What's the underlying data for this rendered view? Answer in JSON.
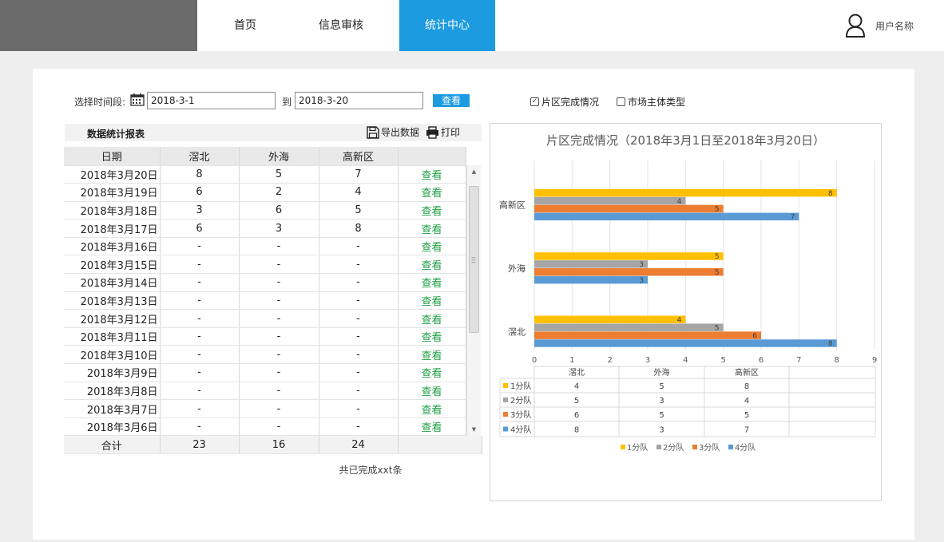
{
  "nav": {
    "items": [
      "首页",
      "信息审核",
      "统计中心"
    ],
    "active": "统计中心",
    "user_name": "用户名称"
  },
  "filter": {
    "label": "选择时间段:",
    "start": "2018-3-1",
    "to": "到",
    "end": "2018-3-20",
    "view_button": "查看",
    "options": [
      {
        "label": "片区完成情况",
        "checked": true
      },
      {
        "label": "市场主体类型",
        "checked": false
      }
    ]
  },
  "report": {
    "title": "数据统计报表",
    "export_label": "导出数据",
    "print_label": "打印",
    "columns": [
      "日期",
      "滘北",
      "外海",
      "高新区",
      ""
    ],
    "rows": [
      [
        "2018年3月20日",
        "8",
        "5",
        "7",
        "查看"
      ],
      [
        "2018年3月19日",
        "6",
        "2",
        "4",
        "查看"
      ],
      [
        "2018年3月18日",
        "3",
        "6",
        "5",
        "查看"
      ],
      [
        "2018年3月17日",
        "6",
        "3",
        "8",
        "查看"
      ],
      [
        "2018年3月16日",
        "-",
        "-",
        "-",
        "查看"
      ],
      [
        "2018年3月15日",
        "-",
        "-",
        "-",
        "查看"
      ],
      [
        "2018年3月14日",
        "-",
        "-",
        "-",
        "查看"
      ],
      [
        "2018年3月13日",
        "-",
        "-",
        "-",
        "查看"
      ],
      [
        "2018年3月12日",
        "-",
        "-",
        "-",
        "查看"
      ],
      [
        "2018年3月11日",
        "-",
        "-",
        "-",
        "查看"
      ],
      [
        "2018年3月10日",
        "-",
        "-",
        "-",
        "查看"
      ],
      [
        "2018年3月9日",
        "-",
        "-",
        "-",
        "查看"
      ],
      [
        "2018年3月8日",
        "-",
        "-",
        "-",
        "查看"
      ],
      [
        "2018年3月7日",
        "-",
        "-",
        "-",
        "查看"
      ],
      [
        "2018年3月6日",
        "-",
        "-",
        "-",
        "查看"
      ]
    ],
    "total": [
      "合计",
      "23",
      "16",
      "24",
      ""
    ],
    "footer": "共已完成xxt条"
  },
  "chart_data": {
    "type": "bar",
    "orientation": "horizontal",
    "title": "片区完成情况（2018年3月1日至2018年3月20日）",
    "categories": [
      "滘北",
      "外海",
      "高新区"
    ],
    "series": [
      {
        "name": "1分队",
        "values": [
          4,
          5,
          8
        ],
        "color": "#ffc000"
      },
      {
        "name": "2分队",
        "values": [
          5,
          3,
          4
        ],
        "color": "#a5a5a5"
      },
      {
        "name": "3分队",
        "values": [
          6,
          5,
          5
        ],
        "color": "#ed7d31"
      },
      {
        "name": "4分队",
        "values": [
          8,
          3,
          7
        ],
        "color": "#5b9bd5"
      }
    ],
    "xlim": [
      0,
      9
    ],
    "xticks": [
      "0",
      "1",
      "2",
      "3",
      "4",
      "5",
      "6",
      "7",
      "8",
      "9"
    ],
    "grid": true,
    "legend": "bottom",
    "data_table": true
  }
}
